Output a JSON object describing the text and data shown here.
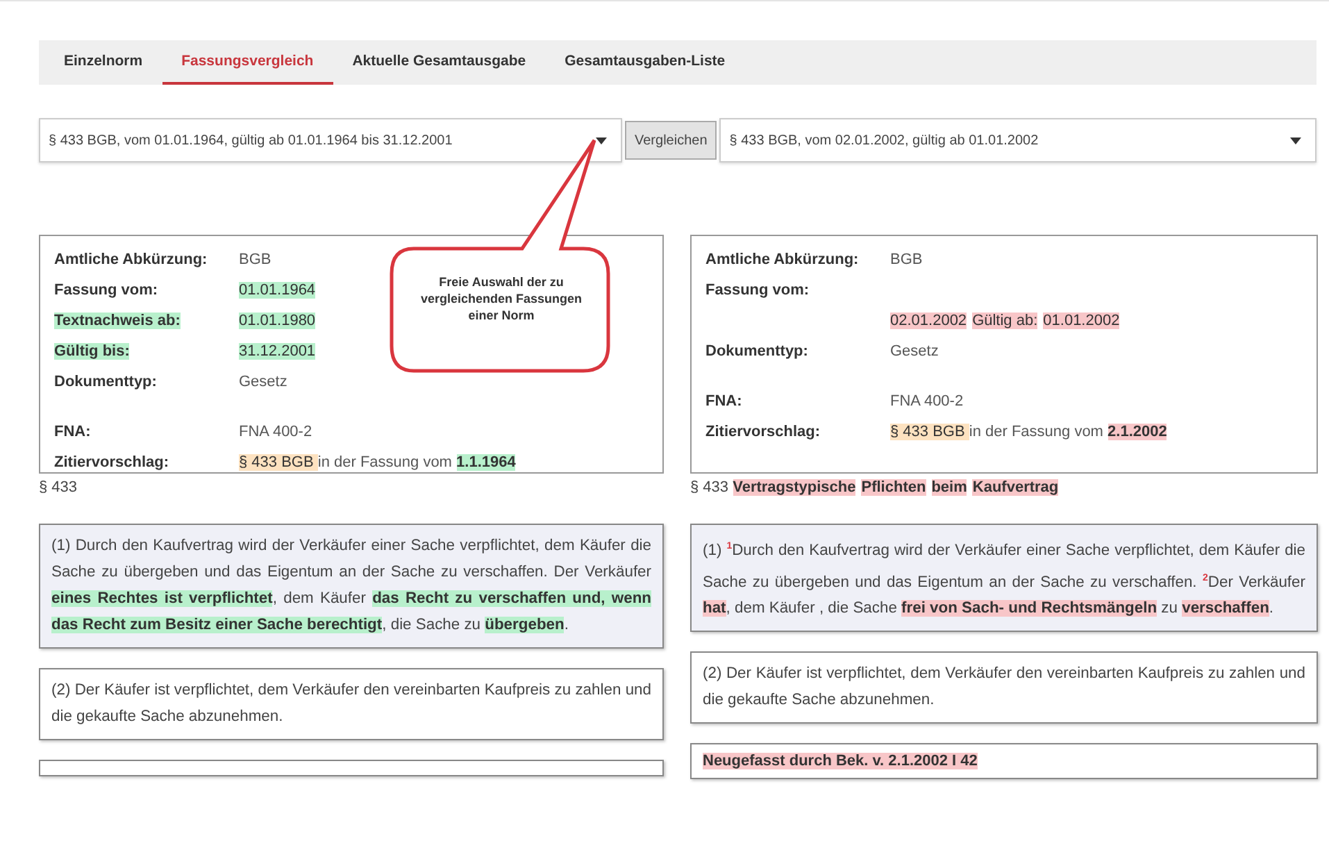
{
  "tabs": [
    {
      "label": "Einzelnorm",
      "selected": false
    },
    {
      "label": "Fassungsvergleich",
      "selected": true
    },
    {
      "label": "Aktuelle Gesamtausgabe",
      "selected": false
    },
    {
      "label": "Gesamtausgaben-Liste",
      "selected": false
    }
  ],
  "compare": {
    "left_select": "§ 433 BGB, vom 01.01.1964, gültig ab 01.01.1964 bis 31.12.2001",
    "button": "Vergleichen",
    "right_select": "§ 433 BGB, vom 02.01.2002, gültig ab 01.01.2002"
  },
  "callout": {
    "text": "Freie Auswahl der zu vergleichenden Fassungen einer Norm"
  },
  "columns": [
    {
      "meta": [
        {
          "label": {
            "t": "Amtliche Abkürzung:"
          },
          "value": [
            {
              "t": "BGB"
            }
          ]
        },
        {
          "label": {
            "t": "Fassung vom:"
          },
          "value": [
            {
              "t": "01.01.1964",
              "color": "#b8f0cc"
            }
          ]
        },
        {
          "label": {
            "t": "Textnachweis ab:",
            "color": "#b8f0cc"
          },
          "value": [
            {
              "t": "01.01.1980",
              "color": "#b8f0cc"
            }
          ]
        },
        {
          "label": {
            "t": "Gültig bis:",
            "color": "#b8f0cc"
          },
          "value": [
            {
              "t": "31.12.2001 ",
              "color": "#b8f0cc"
            }
          ]
        },
        {
          "label": {
            "t": "Dokumenttyp:"
          },
          "value": [
            {
              "t": "Gesetz"
            }
          ]
        },
        {
          "label": {
            "t": "FNA:"
          },
          "value": [
            {
              "t": "FNA 400-2"
            }
          ],
          "gap_before": true
        },
        {
          "label": {
            "t": "Zitiervorschlag:"
          },
          "value": [
            {
              "t": " § 433 BGB ",
              "color": "#fde2c0"
            },
            {
              "t": " in der Fassung vom "
            },
            {
              "t": "1.1.1964",
              "color": "#b8f0cc",
              "b": true
            }
          ]
        }
      ],
      "heading": [
        {
          "t": "§ 433"
        }
      ],
      "paragraphs": [
        {
          "shaded": true,
          "segments": [
            {
              "t": "(1) Durch den Kaufvertrag wird der Verkäufer einer Sache verpflichtet, dem Käufer die Sache zu übergeben und das Eigentum an der Sache zu verschaffen. Der Verkäufer "
            },
            {
              "t": "eines Rechtes ist verpflichtet",
              "color": "#b8f0cc",
              "b": true
            },
            {
              "t": ", dem Käufer "
            },
            {
              "t": "das Recht zu verschaffen und, wenn das Recht zum Besitz einer Sache berechtigt",
              "color": "#b8f0cc",
              "b": true
            },
            {
              "t": ", die Sache zu "
            },
            {
              "t": "übergeben",
              "color": "#b8f0cc",
              "b": true
            },
            {
              "t": "."
            }
          ]
        },
        {
          "shaded": false,
          "segments": [
            {
              "t": "(2) Der Käufer ist verpflichtet, dem Verkäufer den vereinbarten Kaufpreis zu zahlen und die gekaufte Sache abzunehmen."
            }
          ]
        }
      ]
    },
    {
      "meta": [
        {
          "label": {
            "t": "Amtliche Abkürzung:"
          },
          "value": [
            {
              "t": "BGB"
            }
          ]
        },
        {
          "label": {
            "t": "Fassung vom:"
          }
        },
        {
          "value": [
            {
              "t": "02.01.2002",
              "color": "#f8c6c8"
            },
            {
              "t": "Gültig ab:",
              "color": "#f8c6c8"
            },
            {
              "t": "01.01.2002",
              "color": "#f8c6c8"
            }
          ]
        },
        {
          "label": {
            "t": "Dokumenttyp:"
          },
          "value": [
            {
              "t": "Gesetz"
            }
          ]
        },
        {
          "label": {
            "t": "FNA:"
          },
          "value": [
            {
              "t": "FNA 400-2"
            }
          ],
          "gap_before": true
        },
        {
          "label": {
            "t": "Zitiervorschlag:"
          },
          "value": [
            {
              "t": " § 433 BGB ",
              "color": "#fde2c0"
            },
            {
              "t": " in der Fassung vom "
            },
            {
              "t": "2.1.2002",
              "color": "#f8c6c8",
              "b": true
            }
          ]
        }
      ],
      "heading": [
        {
          "t": "§ 433 "
        },
        {
          "t": "Vertragstypische",
          "color": "#f8c6c8",
          "b": true
        },
        {
          "t": "Pflichten",
          "color": "#f8c6c8",
          "b": true
        },
        {
          "t": "beim",
          "color": "#f8c6c8",
          "b": true
        },
        {
          "t": "Kaufvertrag",
          "color": "#f8c6c8",
          "b": true
        }
      ],
      "paragraphs": [
        {
          "shaded": true,
          "segments": [
            {
              "t": "(1) "
            },
            {
              "t": "1",
              "sup": true
            },
            {
              "t": "Durch den Kaufvertrag wird der Verkäufer einer Sache verpflichtet, dem Käufer die Sache zu übergeben und das Eigentum an der Sache zu verschaffen. "
            },
            {
              "t": "2",
              "sup": true
            },
            {
              "t": "Der Verkäufer "
            },
            {
              "t": "hat",
              "color": "#f8c6c8",
              "b": true
            },
            {
              "t": ", dem Käufer , die Sache "
            },
            {
              "t": "frei von Sach- und Rechtsmängeln",
              "color": "#f8c6c8",
              "b": true
            },
            {
              "t": " zu "
            },
            {
              "t": "verschaffen",
              "color": "#f8c6c8",
              "b": true
            },
            {
              "t": "."
            }
          ]
        },
        {
          "shaded": false,
          "segments": [
            {
              "t": "(2) Der Käufer ist verpflichtet, dem Verkäufer den vereinbarten Kaufpreis zu zahlen und die gekaufte Sache abzunehmen."
            }
          ]
        }
      ],
      "note": [
        {
          "t": "Neugefasst durch Bek. v. 2.1.2002 I 42",
          "color": "#f8c6c8",
          "b": true
        }
      ]
    }
  ]
}
